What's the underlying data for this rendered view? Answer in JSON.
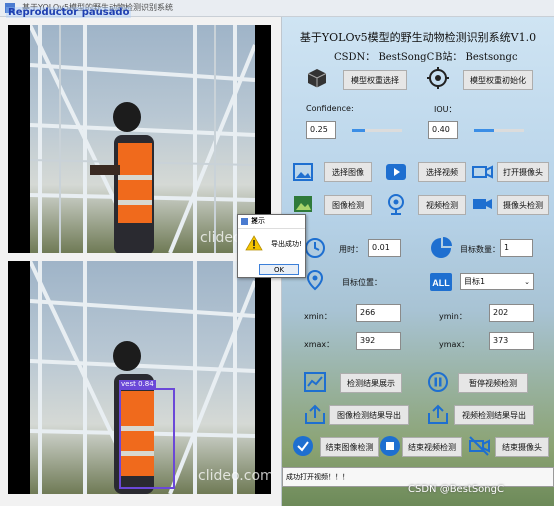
{
  "window": {
    "title": "基于YOLOv5模型的野生动物检测识别系统",
    "overlay_text": "Reproductor pausado"
  },
  "header": {
    "title": "基于YOLOv5模型的野生动物检测识别系统V1.0",
    "csdn": "CSDN：  BestSongC",
    "bilibili": "B站：  Bestsongc"
  },
  "model": {
    "select_label": "模型权重选择",
    "init_label": "模型权重初始化"
  },
  "params": {
    "confidence_label": "Confidence:",
    "confidence_value": "0.25",
    "confidence_level": 0.25,
    "iou_label": "IOU：",
    "iou_value": "0.40",
    "iou_level": 0.4
  },
  "actions": {
    "select_image": "选择图像",
    "select_video": "选择视频",
    "open_camera": "打开摄像头",
    "image_detect": "图像检测",
    "video_detect": "视频检测",
    "camera_detect": "摄像头检测"
  },
  "results": {
    "time_label": "用时：",
    "time_value": "0.01",
    "count_label": "目标数量：",
    "count_value": "1",
    "position_label": "目标位置：",
    "target_select": "目标1",
    "xmin_label": "xmin：",
    "xmin_value": "266",
    "ymin_label": "ymin：",
    "ymin_value": "202",
    "xmax_label": "xmax：",
    "xmax_value": "392",
    "ymax_label": "ymax：",
    "ymax_value": "373"
  },
  "bottom": {
    "show_results": "检测结果展示",
    "pause_video": "暂停视频检测",
    "export_image": "图像检测结果导出",
    "export_video": "视频检测结果导出",
    "end_image": "结束图像检测",
    "end_video": "结束视频检测",
    "end_camera": "结束摄像头"
  },
  "status_text": "成功打开视频！！！",
  "watermark": "CSDN @BestSongC",
  "video": {
    "watermark": "clideo.com",
    "detection_label": "vest 0.84"
  },
  "dialog": {
    "title": "提示",
    "message": "导出成功!",
    "ok": "OK",
    "close": "✕"
  },
  "colors": {
    "accent": "#3b8ee6",
    "detection_box": "#6b48d8"
  }
}
